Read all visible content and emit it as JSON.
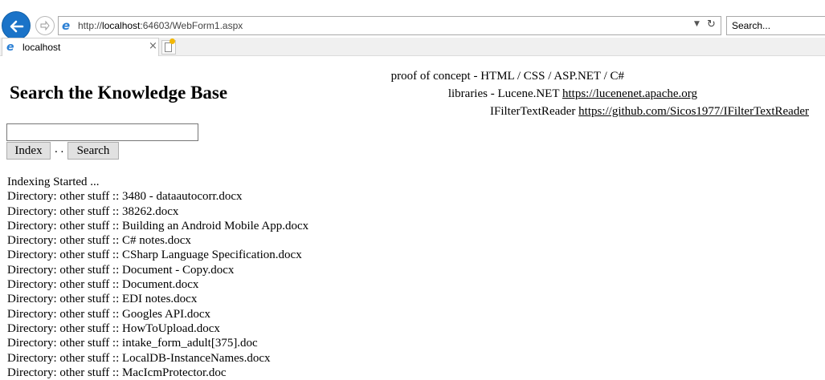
{
  "browser": {
    "url_prefix": "http://",
    "url_host": "localhost",
    "url_rest": ":64603/WebForm1.aspx",
    "search_placeholder": "Search...",
    "tab_label": "localhost",
    "tab_close": "×",
    "accent_color": "#1a73c8"
  },
  "page": {
    "credit_line1": "proof of concept - HTML / CSS / ASP.NET / C#",
    "credit_line2_label": "libraries - Lucene.NET ",
    "credit_line2_link": "https://lucenenet.apache.org",
    "credit_line3_label": "IFilterTextReader ",
    "credit_line3_link": "https://github.com/Sicos1977/IFilterTextReader",
    "title": "Search the Knowledge Base",
    "query_value": "",
    "index_label": "Index",
    "separator": ". .",
    "search_label": "Search",
    "log_lines": [
      "Indexing Started ...",
      "Directory: other stuff :: 3480 - dataautocorr.docx",
      "Directory: other stuff :: 38262.docx",
      "Directory: other stuff :: Building an Android Mobile App.docx",
      "Directory: other stuff :: C# notes.docx",
      "Directory: other stuff :: CSharp Language Specification.docx",
      "Directory: other stuff :: Document - Copy.docx",
      "Directory: other stuff :: Document.docx",
      "Directory: other stuff :: EDI notes.docx",
      "Directory: other stuff :: Googles API.docx",
      "Directory: other stuff :: HowToUpload.docx",
      "Directory: other stuff :: intake_form_adult[375].doc",
      "Directory: other stuff :: LocalDB-InstanceNames.docx",
      "Directory: other stuff :: MacIcmProtector.doc"
    ]
  }
}
